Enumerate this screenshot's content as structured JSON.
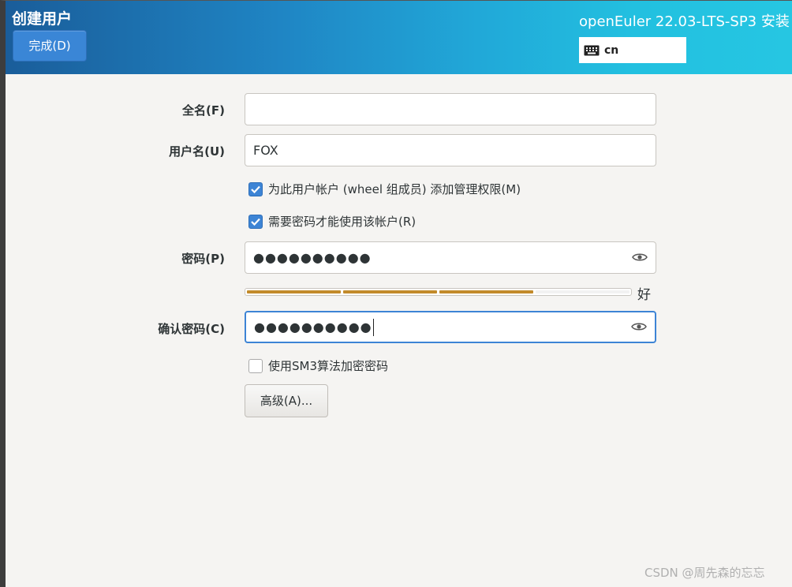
{
  "header": {
    "title": "创建用户",
    "done_label": "完成(D)",
    "product": "openEuler 22.03-LTS-SP3 安装",
    "keyboard_layout": "cn"
  },
  "form": {
    "fullname_label": "全名(F)",
    "fullname_value": "",
    "username_label": "用户名(U)",
    "username_value": "FOX",
    "admin_checkbox": {
      "label": "为此用户帐户 (wheel 组成员) 添加管理权限(M)",
      "checked": true
    },
    "require_password_checkbox": {
      "label": "需要密码才能使用该帐户(R)",
      "checked": true
    },
    "password_label": "密码(P)",
    "password_mask": "●●●●●●●●●●",
    "strength": {
      "level_fraction": 0.75,
      "label": "好",
      "color": "#c28a2a"
    },
    "confirm_label": "确认密码(C)",
    "confirm_mask": "●●●●●●●●●●",
    "sm3_checkbox": {
      "label": "使用SM3算法加密密码",
      "checked": false
    },
    "advanced_label": "高级(A)..."
  },
  "watermark": "CSDN @周先森的忘忘"
}
